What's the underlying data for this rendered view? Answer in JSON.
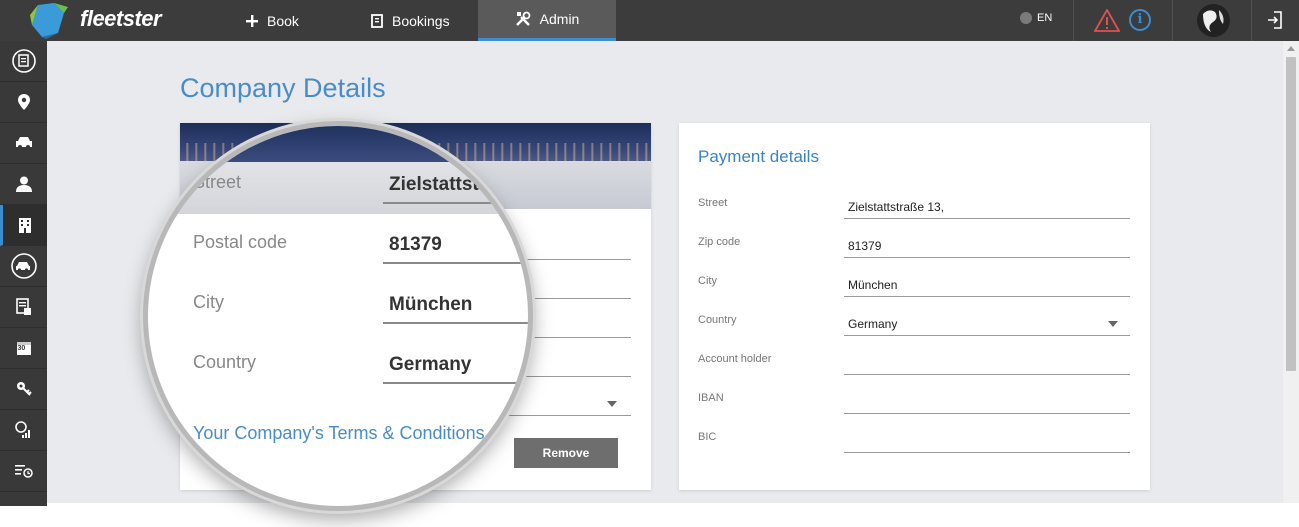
{
  "app": {
    "brand": "fleetster",
    "accent": "#3a8dd0"
  },
  "topnav": {
    "items": [
      {
        "label": "Book",
        "icon": "plus-icon"
      },
      {
        "label": "Bookings",
        "icon": "clipboard-icon"
      },
      {
        "label": "Admin",
        "icon": "wrench-icon",
        "active": true
      }
    ],
    "language": "EN",
    "icons": [
      "globe-icon",
      "warning-icon",
      "info-icon",
      "avatar",
      "logout-icon"
    ]
  },
  "sidebar": {
    "items": [
      {
        "icon": "dashboard-icon"
      },
      {
        "icon": "location-pin-icon"
      },
      {
        "icon": "car-icon"
      },
      {
        "icon": "user-icon"
      },
      {
        "icon": "building-icon",
        "active": true
      },
      {
        "icon": "car-circle-icon"
      },
      {
        "icon": "report-icon"
      },
      {
        "icon": "calendar-icon",
        "calendar_number": "30"
      },
      {
        "icon": "key-icon"
      },
      {
        "icon": "coins-chart-icon"
      },
      {
        "icon": "list-clock-icon"
      }
    ]
  },
  "page": {
    "title": "Company Details"
  },
  "company_card": {
    "remove_label": "Remove",
    "magnified": {
      "street": {
        "label": "Street",
        "value": "Zielstattstr"
      },
      "postal_code": {
        "label": "Postal code",
        "value": "81379"
      },
      "city": {
        "label": "City",
        "value": "München"
      },
      "country": {
        "label": "Country",
        "value": "Germany"
      },
      "terms_link": "Your Company's Terms & Conditions"
    }
  },
  "payment_card": {
    "title": "Payment details",
    "fields": [
      {
        "label": "Street",
        "value": "Zielstattstraße 13,"
      },
      {
        "label": "Zip code",
        "value": "81379"
      },
      {
        "label": "City",
        "value": "München"
      },
      {
        "label": "Country",
        "value": "Germany",
        "dropdown": true
      },
      {
        "label": "Account holder",
        "value": ""
      },
      {
        "label": "IBAN",
        "value": ""
      },
      {
        "label": "BIC",
        "value": ""
      }
    ]
  }
}
